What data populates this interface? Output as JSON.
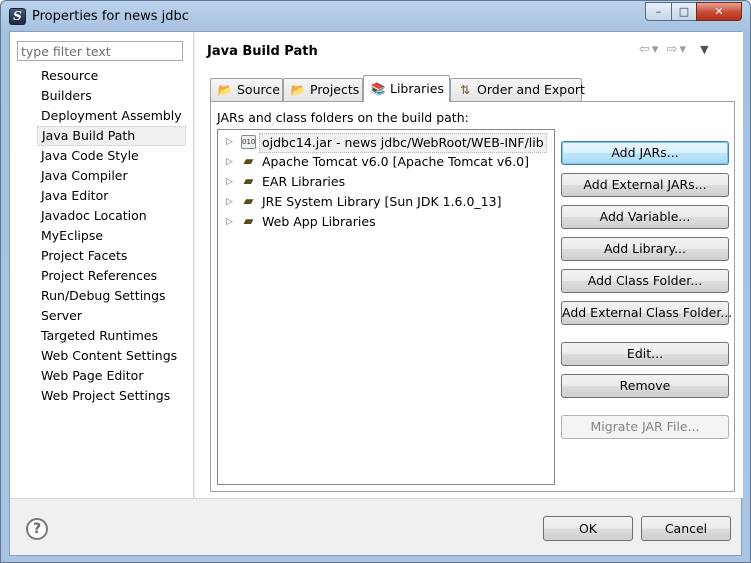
{
  "window": {
    "title": "Properties for news jdbc",
    "app_icon_glyph": "S",
    "controls": {
      "minimize": "–",
      "maximize": "□",
      "close": "✕"
    }
  },
  "filter": {
    "placeholder": "type filter text",
    "value": ""
  },
  "nav": {
    "items": [
      "Resource",
      "Builders",
      "Deployment Assembly",
      "Java Build Path",
      "Java Code Style",
      "Java Compiler",
      "Java Editor",
      "Javadoc Location",
      "MyEclipse",
      "Project Facets",
      "Project References",
      "Run/Debug Settings",
      "Server",
      "Targeted Runtimes",
      "Web Content Settings",
      "Web Page Editor",
      "Web Project Settings"
    ],
    "selected": "Java Build Path"
  },
  "page": {
    "title": "Java Build Path",
    "nav_arrows": {
      "back": "⇦",
      "back_menu": "▾",
      "forward": "⇨",
      "forward_menu": "▾",
      "view_menu": "▼"
    }
  },
  "tabs": [
    {
      "label": "Source",
      "icon": "source-folder-icon",
      "glyph": "📂"
    },
    {
      "label": "Projects",
      "icon": "projects-icon",
      "glyph": "📂"
    },
    {
      "label": "Libraries",
      "icon": "libraries-icon",
      "glyph": "📚",
      "active": true
    },
    {
      "label": "Order and Export",
      "icon": "order-export-icon",
      "glyph": "⇅"
    }
  ],
  "libraries": {
    "caption": "JARs and class folders on the build path:",
    "entries": [
      {
        "label": "ojdbc14.jar - news jdbc/WebRoot/WEB-INF/lib",
        "icon": "jar-icon",
        "glyph": "010",
        "selected": true
      },
      {
        "label": "Apache Tomcat v6.0 [Apache Tomcat v6.0]",
        "icon": "library-icon",
        "glyph": "▰"
      },
      {
        "label": "EAR Libraries",
        "icon": "library-icon",
        "glyph": "▰"
      },
      {
        "label": "JRE System Library [Sun JDK 1.6.0_13]",
        "icon": "library-icon",
        "glyph": "▰"
      },
      {
        "label": "Web App Libraries",
        "icon": "library-icon",
        "glyph": "▰"
      }
    ],
    "expander_glyph": "▷"
  },
  "buttons": {
    "add_jars": "Add JARs...",
    "add_external_jars": "Add External JARs...",
    "add_variable": "Add Variable...",
    "add_library": "Add Library...",
    "add_class_folder": "Add Class Folder...",
    "add_external_class_folder": "Add External Class Folder...",
    "edit": "Edit...",
    "remove": "Remove",
    "migrate_jar": "Migrate JAR File..."
  },
  "dialog": {
    "help_glyph": "?",
    "ok": "OK",
    "cancel": "Cancel"
  }
}
